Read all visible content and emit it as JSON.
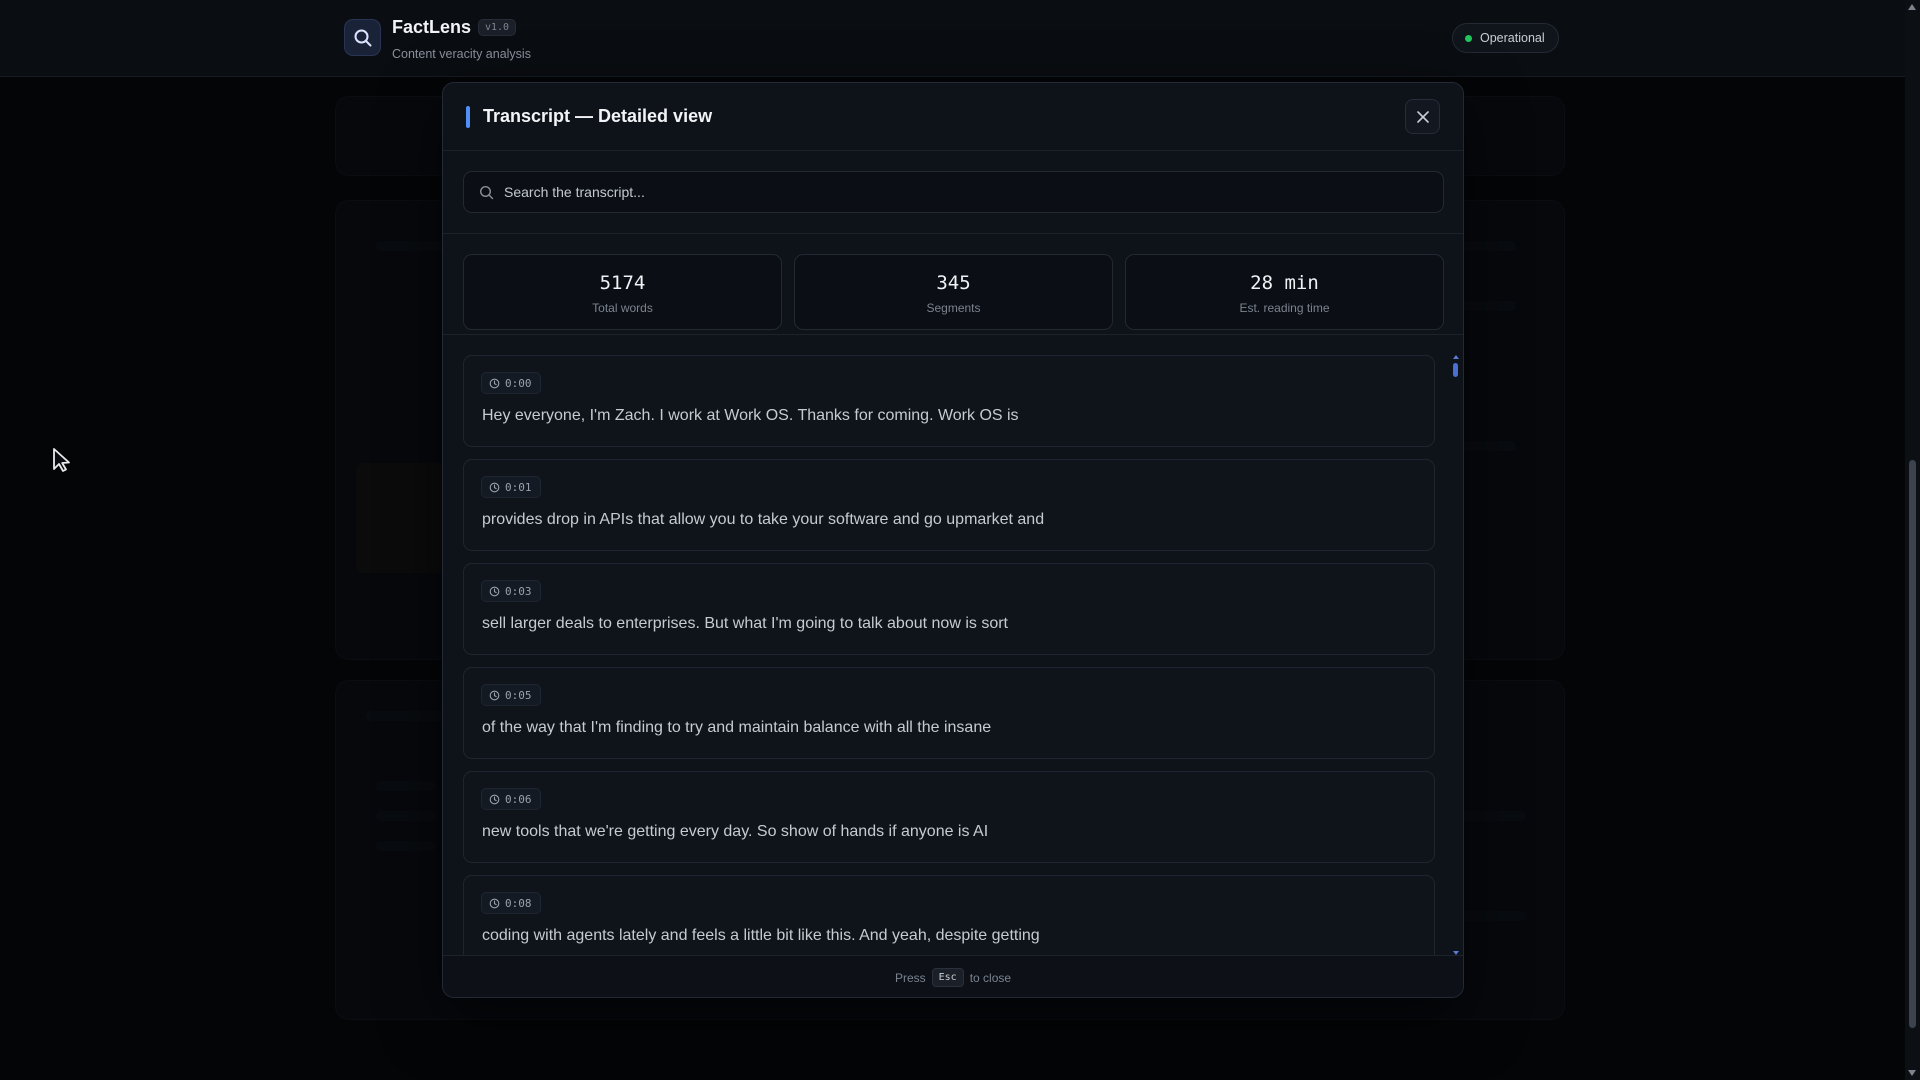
{
  "header": {
    "brand": "FactLens",
    "version": "v1.0",
    "subtitle": "Content veracity analysis",
    "status": "Operational",
    "status_color": "#22c55e",
    "logo_icon": "search-icon"
  },
  "modal": {
    "title": "Transcript — Detailed view",
    "accent_color": "#4f8ff7",
    "close_icon": "close-icon",
    "search": {
      "placeholder": "Search the transcript...",
      "value": ""
    },
    "stats": [
      {
        "value": "5174",
        "label": "Total words"
      },
      {
        "value": "345",
        "label": "Segments"
      },
      {
        "value": "28 min",
        "label": "Est. reading time"
      }
    ],
    "segments": [
      {
        "time": "0:00",
        "text": "Hey everyone, I'm Zach. I work at Work OS. Thanks for coming. Work OS is"
      },
      {
        "time": "0:01",
        "text": "provides drop in APIs that allow you to take your software and go upmarket and"
      },
      {
        "time": "0:03",
        "text": "sell larger deals to enterprises. But what I'm going to talk about now is sort"
      },
      {
        "time": "0:05",
        "text": "of the way that I'm finding to try and maintain balance with all the insane"
      },
      {
        "time": "0:06",
        "text": "new tools that we're getting every day. So show of hands if anyone is AI"
      },
      {
        "time": "0:08",
        "text": "coding with agents lately and feels a little bit like this. And yeah, despite getting"
      }
    ],
    "footer": {
      "press": "Press",
      "key": "Esc",
      "suffix": "to close"
    }
  }
}
